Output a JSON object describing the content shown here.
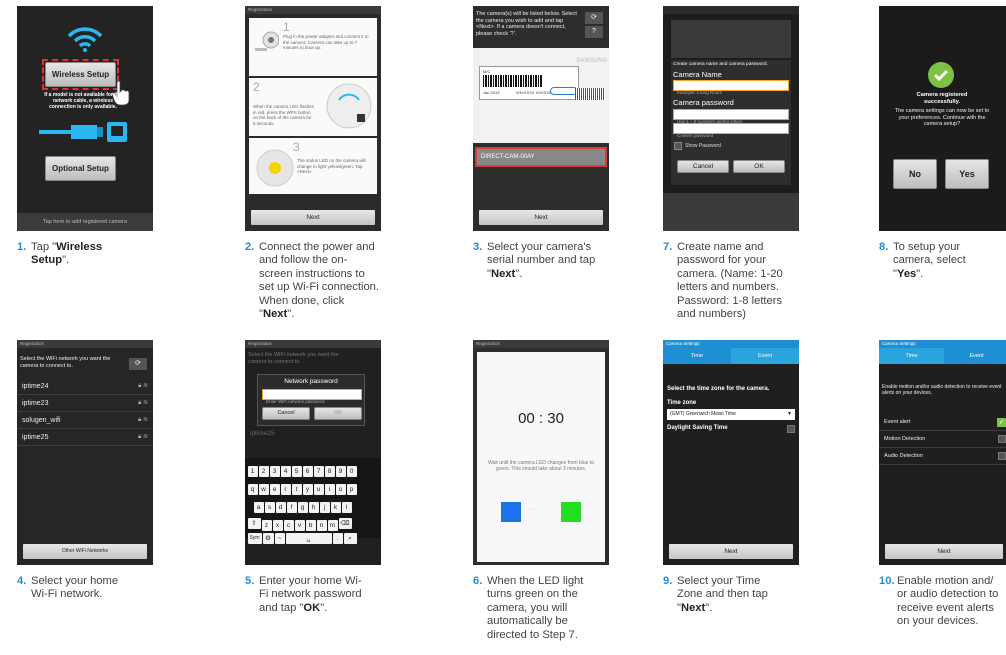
{
  "steps": [
    {
      "num": "1.",
      "pre": "Tap \"",
      "bold": "Wireless Setup",
      "post": "\"."
    },
    {
      "num": "2.",
      "pre": "Connect the power and and follow the on-screen instructions to set up Wi-Fi connection. When done, click \"",
      "bold": "Next",
      "post": "\"."
    },
    {
      "num": "3.",
      "pre": "Select your camera's serial number and tap \"",
      "bold": "Next",
      "post": "\"."
    },
    {
      "num": "7.",
      "pre": "Create name and password for your camera. (Name: 1-20 letters and numbers. Password: 1-8 letters and numbers)",
      "bold": "",
      "post": ""
    },
    {
      "num": "8.",
      "pre": "To setup your camera, select \"",
      "bold": "Yes",
      "post": "\"."
    },
    {
      "num": "4.",
      "pre": "Select your home Wi-Fi network.",
      "bold": "",
      "post": ""
    },
    {
      "num": "5.",
      "pre": "Enter your home Wi-Fi network password and tap \"",
      "bold": "OK",
      "post": "\"."
    },
    {
      "num": "6.",
      "pre": "When the LED light turns green on the camera, you will automatically be directed to Step 7.",
      "bold": "",
      "post": ""
    },
    {
      "num": "9.",
      "pre": "Select your Time Zone and then tap \"",
      "bold": "Next",
      "post": "\"."
    },
    {
      "num": "10.",
      "pre": "Enable motion and/ or audio detection to receive event alerts on your devices.",
      "bold": "",
      "post": ""
    }
  ],
  "s1": {
    "wireless": "Wireless Setup",
    "note": "If a model is not available for the network cable, a wireless connection is only available.",
    "optional": "Optional Setup",
    "footer": "Tap here to add registered camera"
  },
  "s2": {
    "header": "Registration",
    "p1": "Plug in the power adapter and connect it to the camera. Camera can take up to 7 minutes to boot up.",
    "p2": "When the camera LED flashes in red, press the WPS button on the back of the camera for 5 seconds.",
    "p3": "The status LED on the camera will change to light yellow/green. Tap <Next>.",
    "next": "Next"
  },
  "s3": {
    "text": "The camera(s) will be listed below. Select the camera you wish to add and tap <Next>. If a camera doesn't connect, please check '?'.",
    "label_mc": "M/C",
    "label_date": "Jan 2013",
    "label_sn": "S/N:XXXX XXXXXX",
    "brand": "SAMSUNG",
    "cam": "DIRECT-CAM-00AY",
    "next": "Next"
  },
  "s7": {
    "title": "Create camera name and camera password.",
    "name_label": "Camera Name",
    "name_ph": "Example: Living Room",
    "pw_label": "Camera password",
    "pw_ph": "Use 1 ~ 8 numbers and/or letters",
    "confirm_ph": "Confirm password",
    "show": "Show Password",
    "cancel": "Cancel",
    "ok": "OK"
  },
  "s8": {
    "title": "Camera registered successfully.",
    "text": "The camera settings can now be set to your preferences. Continue with the camera setup?",
    "no": "No",
    "yes": "Yes"
  },
  "s4": {
    "header": "Registration",
    "text": "Select the WiFi network you want the camera to connect to.",
    "nets": [
      "iptime24",
      "iptime23",
      "solugen_wifi",
      "iptime25"
    ],
    "other": "Other WiFi Networks"
  },
  "s5": {
    "header": "Registration",
    "text": "Select the WiFi network you want the camera to connect to.",
    "dialog_title": "Network password",
    "placeholder": "Enter WiFi network password",
    "cancel": "Cancel",
    "ok": "OK",
    "bg_net": "iptime25",
    "row1": [
      "1",
      "2",
      "3",
      "4",
      "5",
      "6",
      "7",
      "8",
      "9",
      "0"
    ],
    "row2": [
      "q",
      "w",
      "e",
      "r",
      "t",
      "y",
      "u",
      "i",
      "o",
      "p"
    ],
    "row3": [
      "a",
      "s",
      "d",
      "f",
      "g",
      "h",
      "j",
      "k",
      "l"
    ],
    "row4": [
      "z",
      "x",
      "c",
      "v",
      "b",
      "n",
      "m"
    ],
    "sym": "Sym"
  },
  "s6": {
    "header": "Registration",
    "timer": "00 : 30",
    "text": "Wait until the camera LED changes from blue to green. This should take about 3 minutes.",
    "colors": {
      "blue": "#1a73e8",
      "green": "#22dd22"
    }
  },
  "s9": {
    "header": "Camera Settings",
    "tab1": "Time",
    "tab2": "Event",
    "title": "Select the time zone for the camera.",
    "tz_label": "Time zone",
    "tz_value": "(GMT) Greenwich Mean Time",
    "dst": "Daylight Saving Time",
    "next": "Next"
  },
  "s10": {
    "header": "Camera Settings",
    "tab1": "Time",
    "tab2": "Event",
    "text": "Enable motion and/or audio detection to receive event alerts on your devices.",
    "items": [
      "Event alert",
      "Motion Detection",
      "Audio Detection"
    ],
    "next": "Next"
  },
  "colors": {
    "accent": "#1e8fd2",
    "tab_blue": "#29a4dd",
    "red": "#d93a3a",
    "check_green": "#7dc242"
  }
}
